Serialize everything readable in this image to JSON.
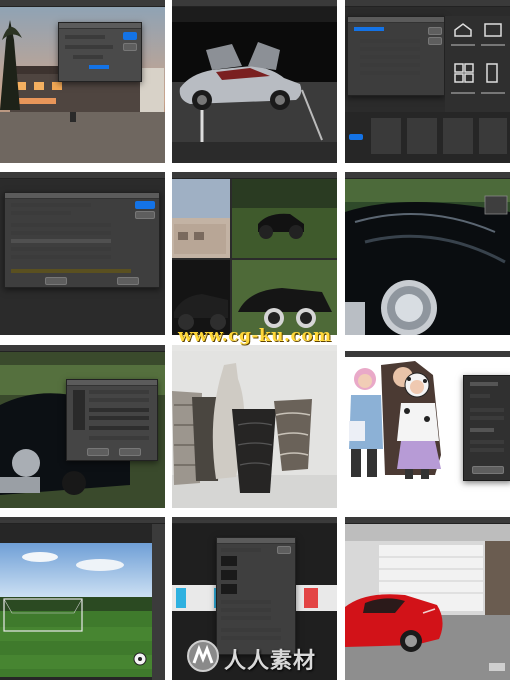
{
  "watermark": {
    "url_text": "www.cg-ku.com",
    "brand_text": "人人素材"
  },
  "tiles": [
    {
      "id": "house-dusk-dialog"
    },
    {
      "id": "silver-gullwing-car"
    },
    {
      "id": "new-document-dialog"
    },
    {
      "id": "camera-raw-dialog"
    },
    {
      "id": "vintage-car-collage"
    },
    {
      "id": "black-car-headlight"
    },
    {
      "id": "image-size-dialog"
    },
    {
      "id": "ceramic-vases"
    },
    {
      "id": "kids-select-mask"
    },
    {
      "id": "soccer-field"
    },
    {
      "id": "content-aware-dialog"
    },
    {
      "id": "red-sports-car"
    }
  ]
}
